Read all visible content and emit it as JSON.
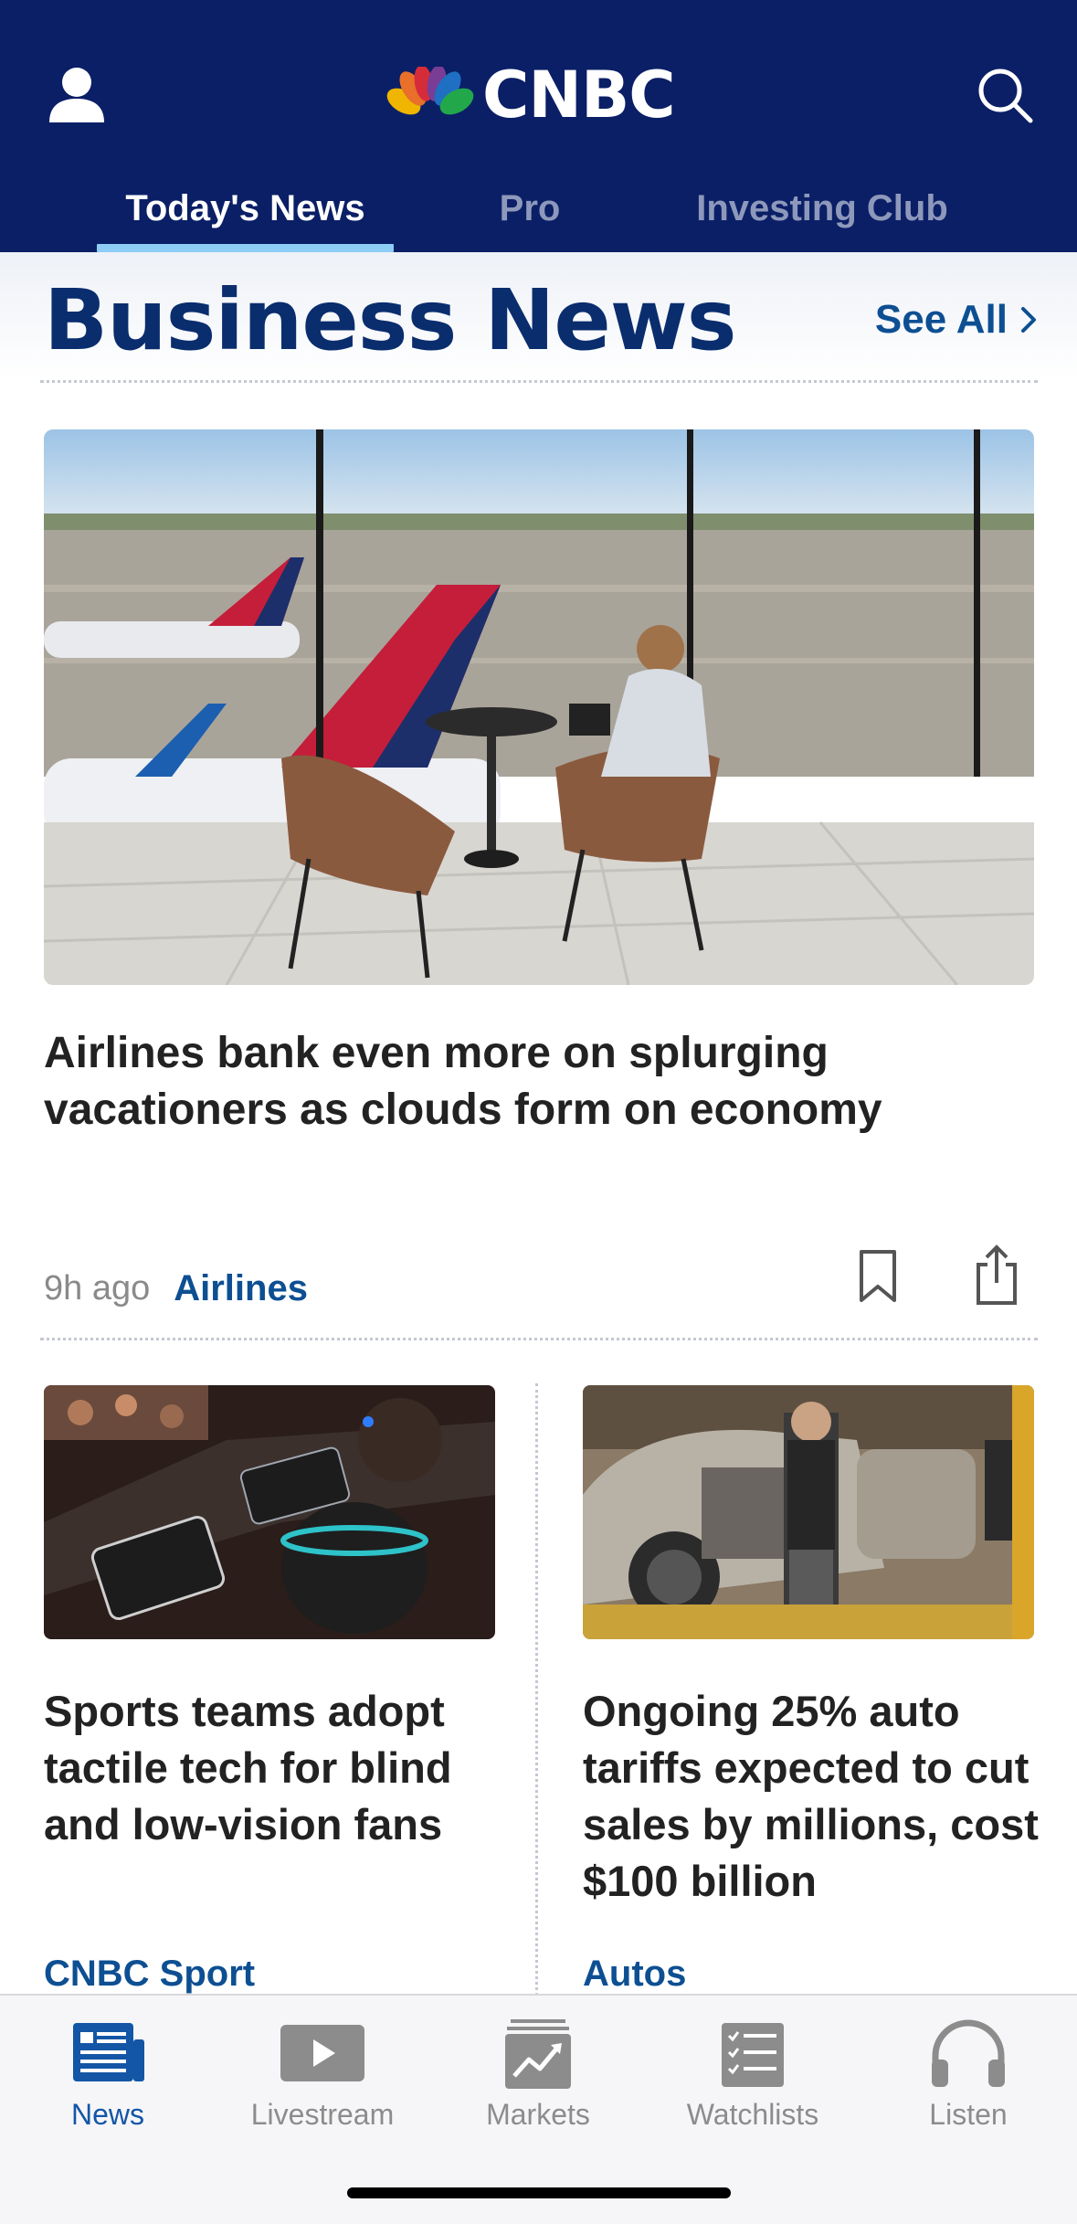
{
  "header": {
    "logo_text": "CNBC",
    "tabs": [
      {
        "label": "Today's News",
        "active": true
      },
      {
        "label": "Pro",
        "active": false
      },
      {
        "label": "Investing Club",
        "active": false
      }
    ],
    "colors": {
      "background": "#0a1f66",
      "active_tab_underline": "#8ecdf5"
    }
  },
  "section": {
    "title": "Business News",
    "see_all_label": "See All"
  },
  "hero": {
    "headline": "Airlines bank even more on splurging vacationers as clouds form on economy",
    "time": "9h ago",
    "tag": "Airlines",
    "image_icon": "airport-lounge-photo"
  },
  "cards": [
    {
      "headline": "Sports teams adopt tactile tech for blind and low-vision fans",
      "tag": "CNBC Sport",
      "image_icon": "tactile-device-photo"
    },
    {
      "headline": "Ongoing 25% auto tariffs expected to cut sales by millions, cost $100 billion",
      "tag": "Autos",
      "image_icon": "auto-factory-photo"
    }
  ],
  "bottom_nav": {
    "items": [
      {
        "label": "News",
        "icon": "news-icon",
        "active": true
      },
      {
        "label": "Livestream",
        "icon": "play-icon",
        "active": false
      },
      {
        "label": "Markets",
        "icon": "markets-chart-icon",
        "active": false
      },
      {
        "label": "Watchlists",
        "icon": "list-icon",
        "active": false
      },
      {
        "label": "Listen",
        "icon": "headphones-icon",
        "active": false
      }
    ],
    "active_color": "#1456a6",
    "inactive_color": "#8c8c8c"
  }
}
